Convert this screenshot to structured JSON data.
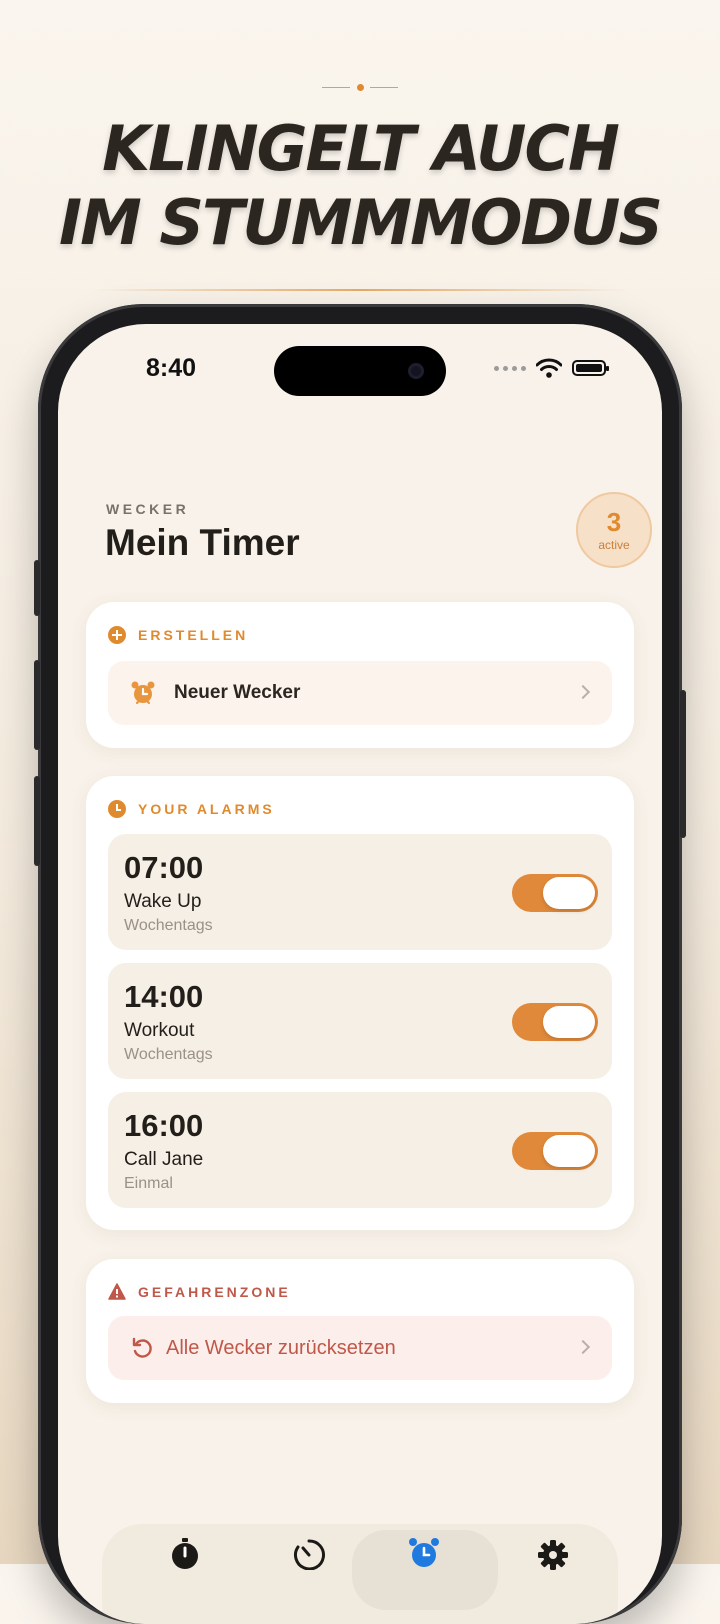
{
  "headline": {
    "line1": "KLINGELT AUCH",
    "line2": "IM STUMMMODUS"
  },
  "status_bar": {
    "time": "8:40"
  },
  "header": {
    "eyebrow": "WECKER",
    "title": "Mein Timer"
  },
  "badge": {
    "count": "3",
    "label": "active"
  },
  "create_section": {
    "title": "ERSTELLEN",
    "new_alarm_label": "Neuer Wecker"
  },
  "alarms_section": {
    "title": "YOUR ALARMS",
    "items": [
      {
        "time": "07:00",
        "name": "Wake Up",
        "repeat": "Wochentags",
        "enabled": true
      },
      {
        "time": "14:00",
        "name": "Workout",
        "repeat": "Wochentags",
        "enabled": true
      },
      {
        "time": "16:00",
        "name": "Call Jane",
        "repeat": "Einmal",
        "enabled": true
      }
    ]
  },
  "danger_section": {
    "title": "GEFAHRENZONE",
    "reset_label": "Alle Wecker zurücksetzen"
  },
  "tabbar": {
    "items": [
      {
        "icon": "stopwatch-icon",
        "active": false
      },
      {
        "icon": "timer-icon",
        "active": false
      },
      {
        "icon": "alarm-clock-icon",
        "active": true
      },
      {
        "icon": "gear-icon",
        "active": false
      }
    ]
  },
  "colors": {
    "accent": "#e08a2e",
    "danger": "#c0584a",
    "active_tab": "#1f7ae0",
    "background": "#f8f2ea"
  }
}
